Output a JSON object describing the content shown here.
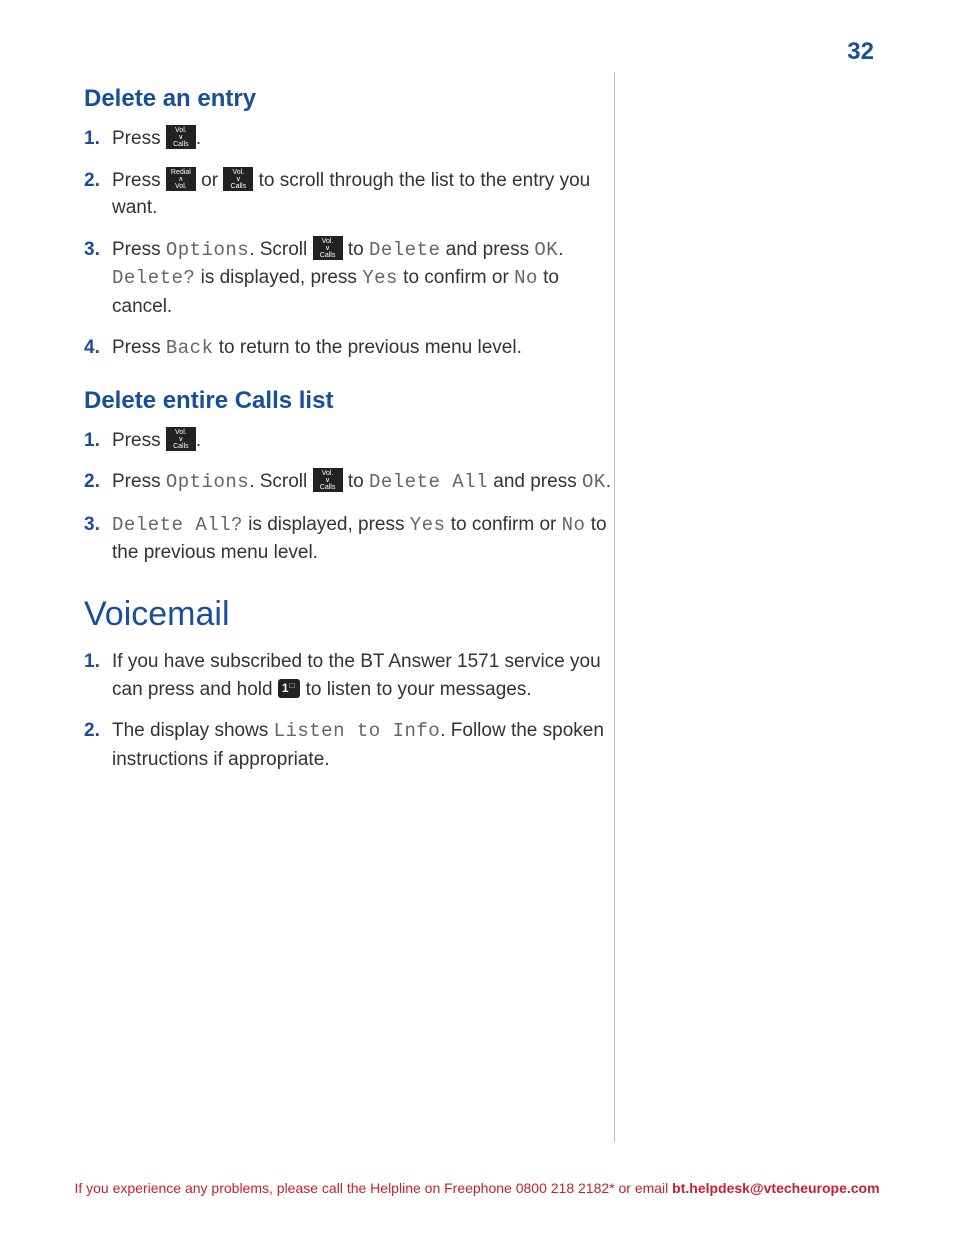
{
  "page_number": "32",
  "sections": {
    "delete_entry": {
      "heading": "Delete an entry",
      "steps": {
        "s1": {
          "num": "1.",
          "a": "Press ",
          "b": "."
        },
        "s2": {
          "num": "2.",
          "a": "Press ",
          "b": " or ",
          "c": " to scroll through the list to the entry you want."
        },
        "s3": {
          "num": "3.",
          "a": "Press ",
          "lcd1": "Options",
          "b": ". Scroll ",
          "c": " to ",
          "lcd2": "Delete",
          "d": " and press ",
          "lcd3": "OK",
          "e": ". ",
          "lcd4": "Delete?",
          "f": " is displayed, press ",
          "lcd5": "Yes",
          "g": " to confirm or ",
          "lcd6": "No",
          "h": " to cancel."
        },
        "s4": {
          "num": "4.",
          "a": "Press ",
          "lcd1": "Back",
          "b": " to return to the previous menu level."
        }
      }
    },
    "delete_all": {
      "heading": "Delete entire Calls list",
      "steps": {
        "s1": {
          "num": "1.",
          "a": "Press ",
          "b": "."
        },
        "s2": {
          "num": "2.",
          "a": "Press ",
          "lcd1": "Options",
          "b": ". Scroll ",
          "c": " to ",
          "lcd2": "Delete All",
          "d": " and press ",
          "lcd3": "OK",
          "e": "."
        },
        "s3": {
          "num": "3.",
          "lcd1": "Delete All?",
          "a": " is displayed, press ",
          "lcd2": "Yes",
          "b": " to confirm or ",
          "lcd3": "No",
          "c": " to the previous menu level."
        }
      }
    },
    "voicemail": {
      "heading": "Voicemail",
      "steps": {
        "s1": {
          "num": "1.",
          "a": "If you have subscribed to the BT Answer 1571 service you can press and hold ",
          "b": " to listen to your messages."
        },
        "s2": {
          "num": "2.",
          "a": "The display shows ",
          "lcd1": "Listen to Info",
          "b": ". Follow the spoken instructions if appropriate."
        }
      }
    }
  },
  "buttons": {
    "down": {
      "t": "Vol.",
      "m": "∨",
      "b": "Calls"
    },
    "up": {
      "t": "Redial",
      "m": "∧",
      "b": "Vol."
    },
    "one": {
      "digit": "1",
      "sup": "□"
    }
  },
  "footer": {
    "a": "If you experience any problems, please call the Helpline on Freephone 0800 218 2182* or email ",
    "b": "bt.helpdesk@vtecheurope.com"
  }
}
